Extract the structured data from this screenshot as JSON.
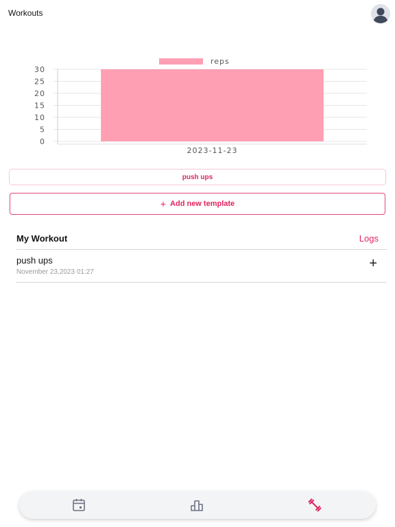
{
  "header": {
    "title": "Workouts"
  },
  "chart_data": {
    "type": "bar",
    "categories": [
      "2023-11-23"
    ],
    "series": [
      {
        "name": "reps",
        "values": [
          30
        ]
      }
    ],
    "ylim": [
      0,
      30
    ],
    "yticks": [
      "0",
      "5",
      "10",
      "15",
      "20",
      "25",
      "30"
    ],
    "legend": "top",
    "grid": true,
    "color": "#ff9fb3"
  },
  "template_chip": {
    "label": "push ups"
  },
  "add_template": {
    "icon": "+",
    "label": "Add new template"
  },
  "my_workout": {
    "title": "My Workout",
    "logs_label": "Logs",
    "items": [
      {
        "name": "push ups",
        "date": "November 23,2023 01:27",
        "action_icon": "+"
      }
    ]
  },
  "nav": {
    "items": [
      "calendar-icon",
      "bar-chart-icon",
      "dumbbell-icon"
    ],
    "active_color": "#e0245e",
    "inactive_color": "#6b7280"
  },
  "colors": {
    "accent": "#e0245e",
    "bar": "#ff9fb3"
  }
}
